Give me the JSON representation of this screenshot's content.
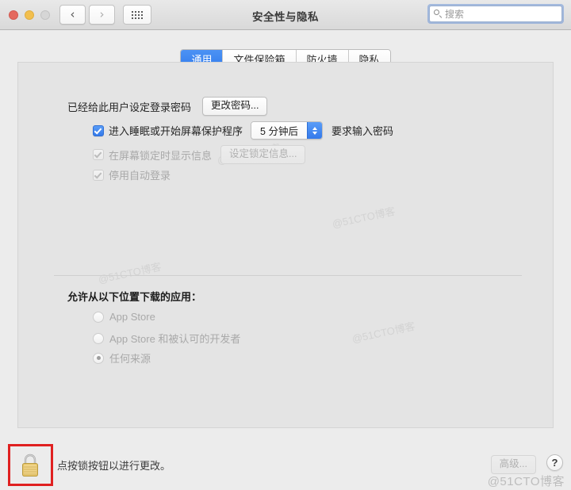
{
  "window": {
    "title": "安全性与隐私",
    "traffic_lights": [
      "close",
      "minimize",
      "zoom"
    ],
    "nav": {
      "back": "‹",
      "forward": "›",
      "show_all": "show-all-grid"
    },
    "search": {
      "placeholder": "搜索",
      "value": ""
    }
  },
  "tabs": [
    {
      "label": "通用",
      "active": true
    },
    {
      "label": "文件保险箱",
      "active": false
    },
    {
      "label": "防火墙",
      "active": false
    },
    {
      "label": "隐私",
      "active": false
    }
  ],
  "general": {
    "login_password_label": "已经给此用户设定登录密码",
    "change_password_button": "更改密码...",
    "require_password": {
      "checkbox_label": "进入睡眠或开始屏幕保护程序",
      "checked": true,
      "delay_value": "5 分钟后",
      "suffix_label": "要求输入密码"
    },
    "lock_message": {
      "checkbox_label": "在屏幕锁定时显示信息",
      "checked": true,
      "enabled": false,
      "button_label": "设定锁定信息..."
    },
    "disable_auto_login": {
      "checkbox_label": "停用自动登录",
      "checked": true,
      "enabled": false
    },
    "download_section": {
      "title": "允许从以下位置下载的应用：",
      "options": [
        {
          "label": "App Store",
          "selected": false
        },
        {
          "label": "App Store 和被认可的开发者",
          "selected": false
        },
        {
          "label": "任何来源",
          "selected": true
        }
      ]
    }
  },
  "footer": {
    "lock_icon": "padlock-closed-icon",
    "lock_hint": "点按锁按钮以进行更改。",
    "advanced_button": "高级...",
    "help_button": "?",
    "highlight_color": "#e02020"
  },
  "watermarks": {
    "main": "@51CTO博客",
    "faint": [
      "@51CTO博客",
      "@51CTO博客",
      "@51CTO博客",
      "@51CTO博客"
    ]
  }
}
